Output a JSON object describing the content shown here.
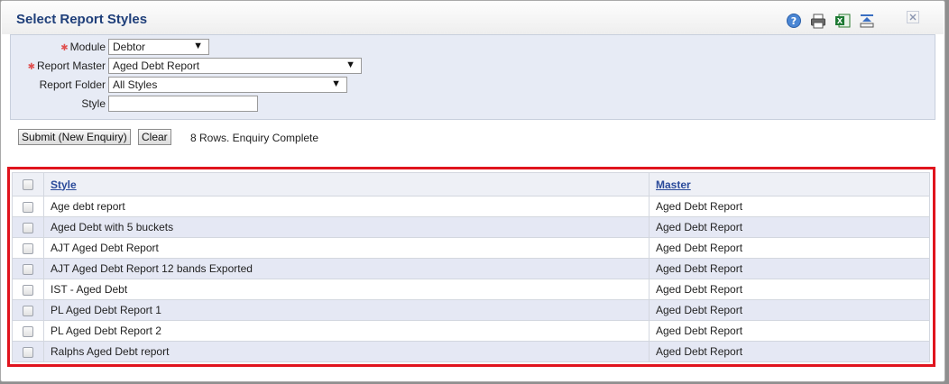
{
  "window": {
    "title": "Select Report Styles"
  },
  "toolbar": {
    "icons": [
      "help-icon",
      "print-icon",
      "excel-export-icon",
      "collapse-icon"
    ],
    "close_icon": "close-icon"
  },
  "criteria": {
    "module": {
      "label": "Module",
      "value": "Debtor",
      "required": true
    },
    "report_master": {
      "label": "Report Master",
      "value": "Aged Debt Report",
      "required": true
    },
    "report_folder": {
      "label": "Report Folder",
      "value": "All Styles",
      "required": false
    },
    "style": {
      "label": "Style",
      "value": "",
      "required": false
    }
  },
  "actions": {
    "submit_label": "Submit (New Enquiry)",
    "clear_label": "Clear",
    "status": "8 Rows. Enquiry Complete"
  },
  "grid": {
    "columns": [
      "Style",
      "Master"
    ],
    "rows": [
      {
        "style": "Age debt report",
        "master": "Aged Debt Report"
      },
      {
        "style": "Aged Debt with 5 buckets",
        "master": "Aged Debt Report"
      },
      {
        "style": "AJT Aged Debt Report",
        "master": "Aged Debt Report"
      },
      {
        "style": "AJT Aged Debt Report 12 bands Exported",
        "master": "Aged Debt Report"
      },
      {
        "style": "IST - Aged Debt",
        "master": "Aged Debt Report"
      },
      {
        "style": "PL Aged Debt Report 1",
        "master": "Aged Debt Report"
      },
      {
        "style": "PL Aged Debt Report 2",
        "master": "Aged Debt Report"
      },
      {
        "style": "Ralphs Aged Debt report",
        "master": "Aged Debt Report"
      }
    ]
  },
  "colors": {
    "title": "#1f3f7a",
    "highlight": "#e0141e",
    "required": "#e05050",
    "row_alt": "#e5e8f4"
  }
}
